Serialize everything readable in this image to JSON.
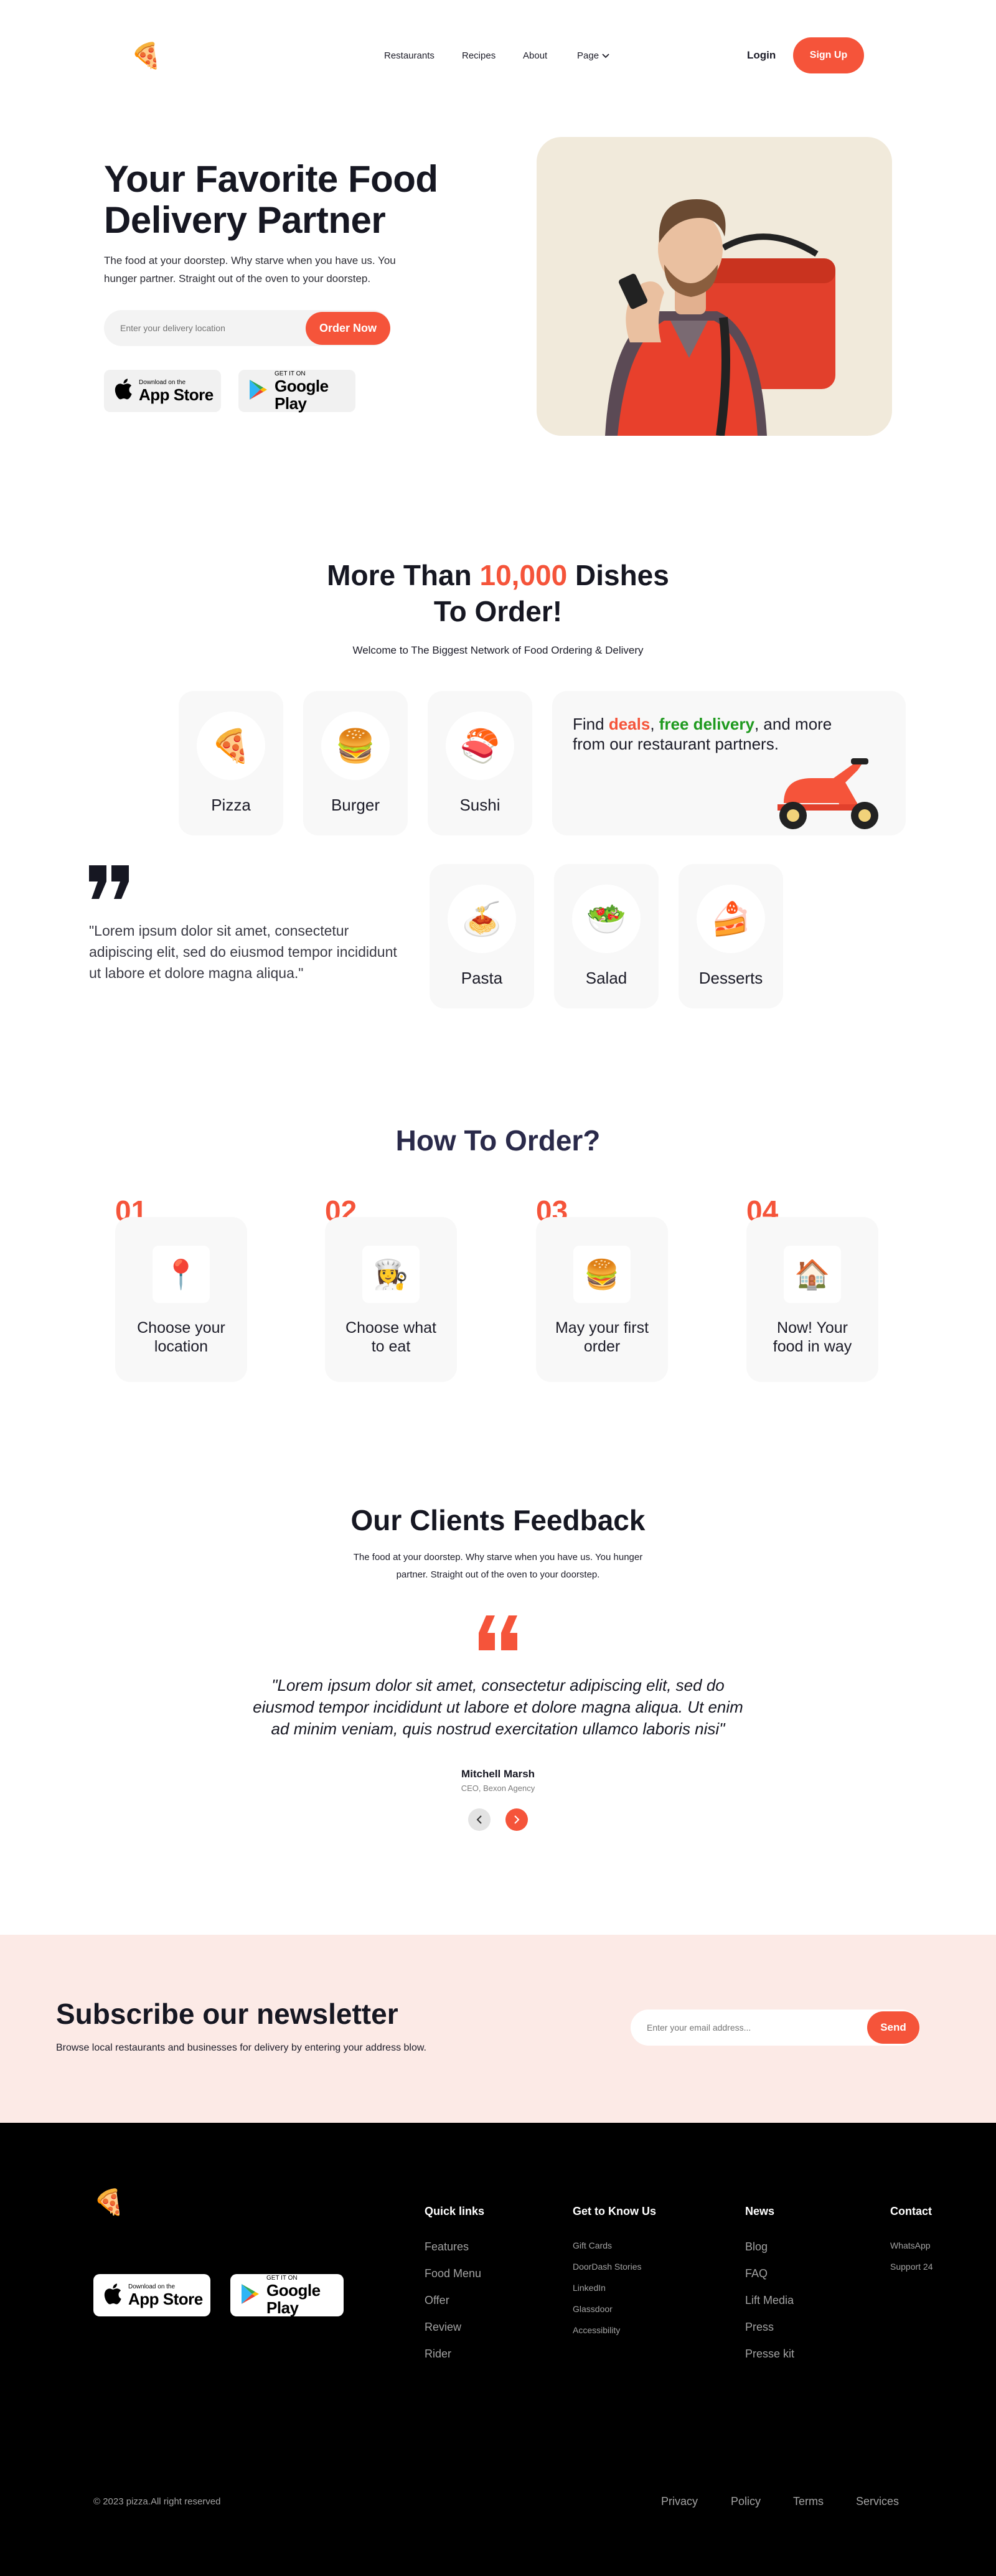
{
  "nav": {
    "links": [
      "Restaurants",
      "Recipes",
      "About",
      "Page"
    ],
    "login": "Login",
    "signup": "Sign Up"
  },
  "hero": {
    "title_line1": "Your Favorite Food",
    "title_line2": "Delivery Partner",
    "subtitle_line1": "The food at your doorstep. Why starve when you have us. You",
    "subtitle_line2": "hunger partner. Straight out of the oven to your doorstep.",
    "location_placeholder": "Enter your delivery location",
    "order_button": "Order Now"
  },
  "app_store": {
    "small": "Download on the",
    "big": "App Store"
  },
  "google_play": {
    "small": "GET IT ON",
    "big": "Google Play"
  },
  "dishes": {
    "title_pre": "More Than ",
    "title_number": "10,000",
    "title_post": " Dishes",
    "title_line2": "To Order!",
    "subtitle": "Welcome to The Biggest Network of Food Ordering & Delivery",
    "items": [
      {
        "name": "Pizza",
        "emoji": "🍕"
      },
      {
        "name": "Burger",
        "emoji": "🍔"
      },
      {
        "name": "Sushi",
        "emoji": "🍣"
      },
      {
        "name": "Pasta",
        "emoji": "🍝"
      },
      {
        "name": "Salad",
        "emoji": "🥗"
      },
      {
        "name": "Desserts",
        "emoji": "🍰"
      }
    ],
    "promo_find": "Find ",
    "promo_deals": "deals",
    "promo_comma": ", ",
    "promo_free": "free delivery",
    "promo_rest1": ", and more",
    "promo_rest2": "from our restaurant partners.",
    "quote_line1": "\"Lorem ipsum dolor sit amet, consectetur",
    "quote_line2": "adipiscing elit, sed do eiusmod tempor incididunt",
    "quote_line3": "ut labore et dolore magna aliqua.\""
  },
  "how_to": {
    "title": "How To Order?",
    "steps": [
      {
        "num": "01",
        "line1": "Choose your",
        "line2": "location",
        "emoji": "📍"
      },
      {
        "num": "02",
        "line1": "Choose what",
        "line2": "to eat",
        "emoji": "👩‍🍳"
      },
      {
        "num": "03",
        "line1": "May your first",
        "line2": "order",
        "emoji": "🍔"
      },
      {
        "num": "04",
        "line1": "Now! Your",
        "line2": "food in way",
        "emoji": "🏠"
      }
    ]
  },
  "feedback": {
    "title": "Our Clients Feedback",
    "subtitle_line1": "The food at your doorstep. Why starve when you have us. You hunger",
    "subtitle_line2": "partner. Straight out of the oven to your doorstep.",
    "quote_line1": "\"Lorem ipsum dolor sit amet, consectetur adipiscing elit, sed do",
    "quote_line2": "eiusmod tempor incididunt ut labore et dolore magna aliqua. Ut enim",
    "quote_line3": "ad minim veniam, quis nostrud exercitation ullamco laboris nisi\"",
    "name": "Mitchell Marsh",
    "role": "CEO, Bexon Agency"
  },
  "newsletter": {
    "title": "Subscribe our newsletter",
    "subtitle": "Browse local restaurants and businesses for delivery by entering your address blow.",
    "email_placeholder": "Enter your email address...",
    "send": "Send"
  },
  "footer": {
    "quick_links": {
      "title": "Quick links",
      "items": [
        "Features",
        "Food Menu",
        "Offer",
        "Review",
        "Rider"
      ]
    },
    "get_to_know": {
      "title": "Get to Know Us",
      "items": [
        "Gift Cards",
        "DoorDash Stories",
        "LinkedIn",
        "Glassdoor",
        "Accessibility"
      ]
    },
    "news": {
      "title": "News",
      "items": [
        "Blog",
        "FAQ",
        "Lift Media",
        "Press",
        "Presse kit"
      ]
    },
    "contact": {
      "title": "Contact",
      "items": [
        "WhatsApp",
        "Support 24"
      ]
    },
    "copyright": "© 2023 pizza.All right reserved",
    "bottom_links": [
      "Privacy",
      "Policy",
      "Terms",
      "Services"
    ]
  },
  "colors": {
    "accent": "#f5543a",
    "free_delivery": "#1f9a1f",
    "dark": "#161722",
    "newsletter_bg": "#fceae6",
    "footer_bg": "#000000"
  }
}
